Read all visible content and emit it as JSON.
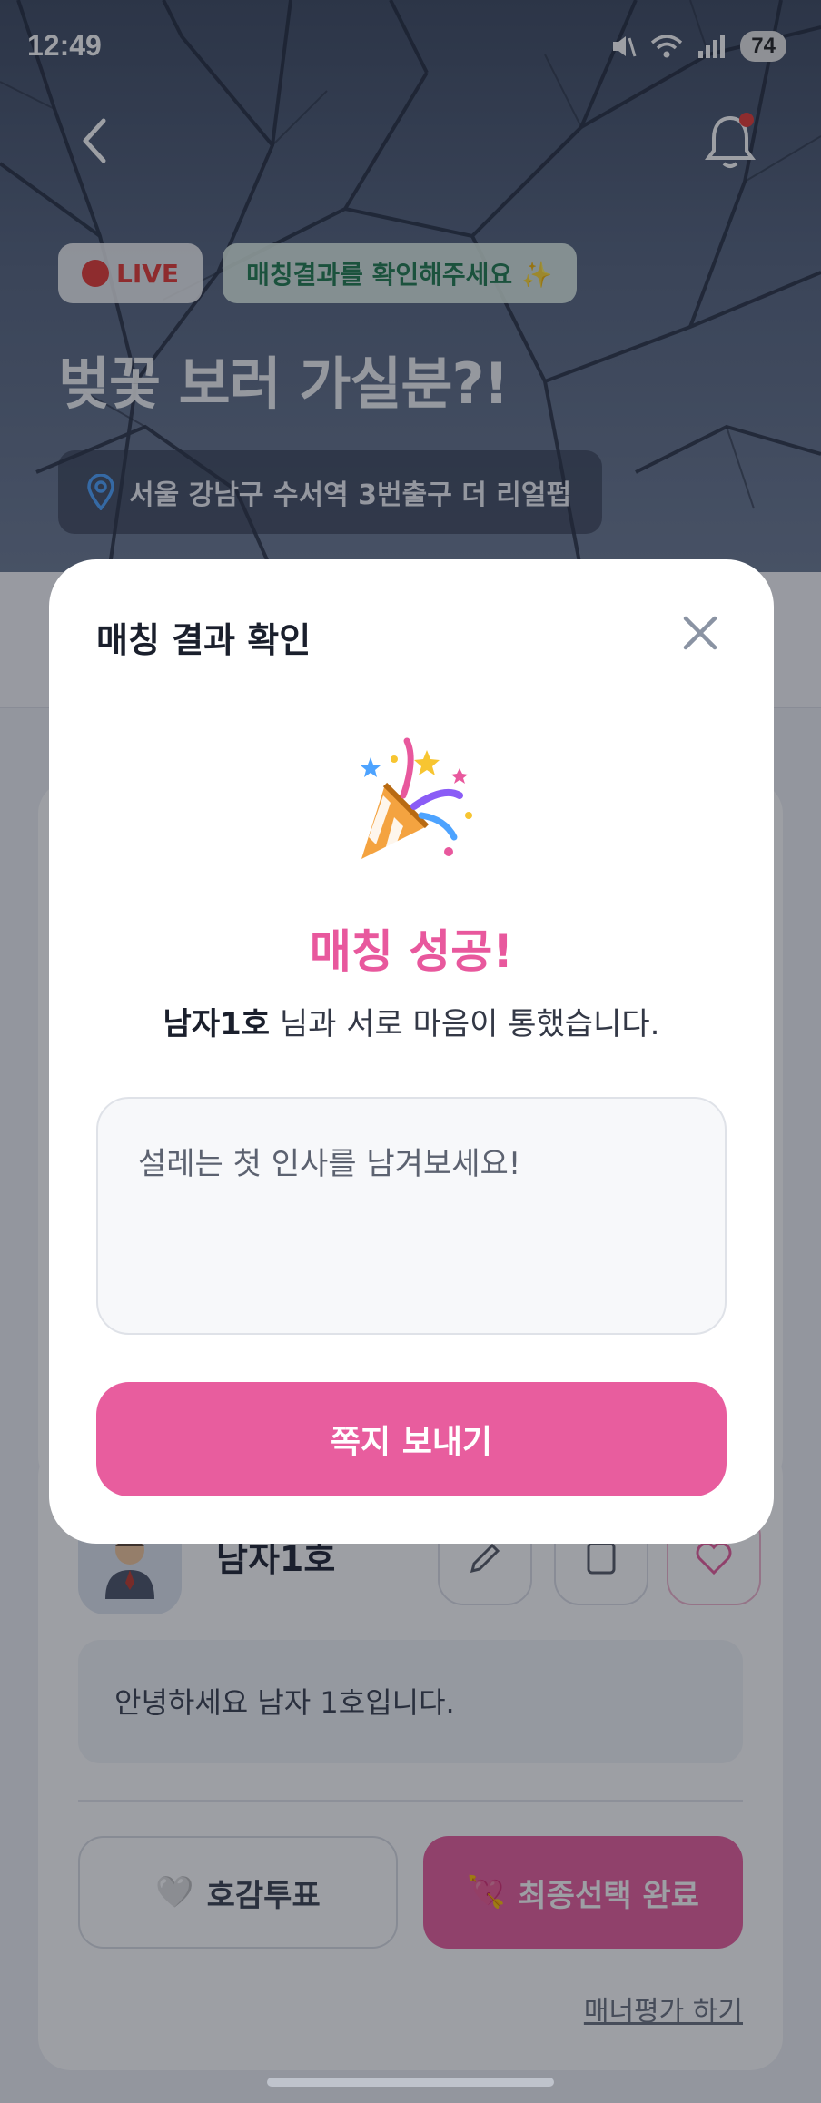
{
  "status_bar": {
    "time": "12:49",
    "battery": "74"
  },
  "event": {
    "live_label": "LIVE",
    "status_chip": "매칭결과를 확인해주세요 ✨",
    "title": "벚꽃 보러 가실분?!",
    "location": "서울 강남구 수서역 3번출구 더 리얼펍"
  },
  "member": {
    "name": "남자1호",
    "intro": "안녕하세요 남자 1호입니다.",
    "vote_label": "호감투표",
    "final_label": "최종선택 완료",
    "manner_link": "매너평가 하기"
  },
  "modal": {
    "title": "매칭 결과 확인",
    "emoji": "🎉",
    "success_text": "매칭 성공!",
    "partner_name": "남자1호",
    "message_suffix": " 님과 서로 마음이 통했습니다.",
    "input_placeholder": "설레는 첫 인사를 남겨보세요!",
    "send_label": "쪽지 보내기"
  },
  "colors": {
    "accent_pink": "#e85d9e",
    "live_red": "#e53935",
    "status_green": "#1f7a4f"
  }
}
